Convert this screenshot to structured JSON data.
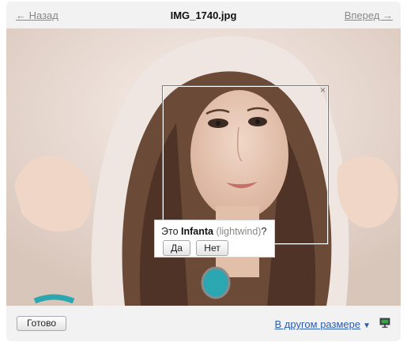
{
  "header": {
    "prev_label": "← Назад",
    "title": "IMG_1740.jpg",
    "next_label": "Вперед →"
  },
  "photo": {
    "close_glyph": "×"
  },
  "tag_prompt": {
    "prefix": "Это ",
    "person_name": "Infanta",
    "login": "(lightwind)",
    "suffix": "?",
    "yes_label": "Да",
    "no_label": "Нет"
  },
  "footer": {
    "done_label": "Готово",
    "size_label": "В другом размере",
    "size_arrow": "▼",
    "monitor_icon": "monitor-icon"
  },
  "colors": {
    "link_gray": "#888888",
    "link_blue": "#2a5db0",
    "panel_bg": "#f2f2f2"
  }
}
